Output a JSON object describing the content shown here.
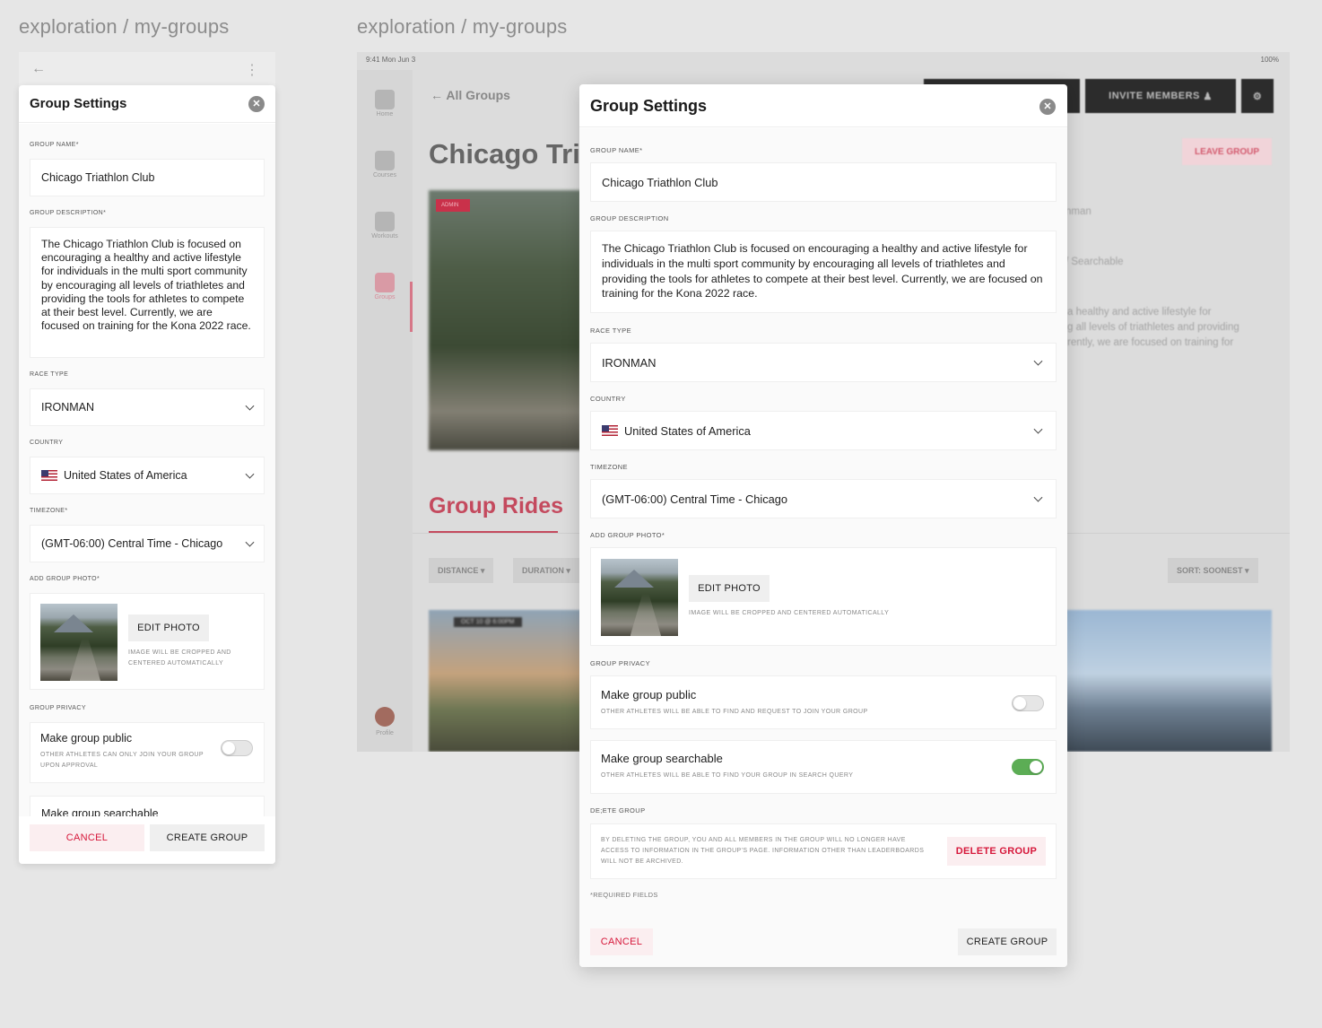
{
  "frames": {
    "left_title": "exploration / my-groups",
    "right_title": "exploration / my-groups"
  },
  "background_app": {
    "status_time": "9:41 Mon Jun 3",
    "status_battery": "100%",
    "nav": [
      "Home",
      "Courses",
      "Workouts",
      "Groups",
      "Profile"
    ],
    "back_label": "All Groups",
    "group_title": "Chicago Tri",
    "admin_badge": "ADMIN",
    "section_title": "Group Rides",
    "filters": [
      "DISTANCE",
      "DURATION"
    ],
    "sort_label": "SORT: SOONEST",
    "ride_date": "OCT 10 @ 6:00PM",
    "invite_label": "INVITE MEMBERS",
    "leave_label": "LEAVE GROUP",
    "ghost_lines": [
      "nman",
      "/ Searchable",
      "a healthy and active lifestyle for",
      "g all levels of triathletes and providing",
      "rently, we are focused on training for"
    ]
  },
  "modal": {
    "title": "Group Settings",
    "group_name_label": "GROUP NAME*",
    "group_name_value": "Chicago Triathlon Club",
    "mobile_description_label": "GROUP DESCRIPTION*",
    "description_label": "GROUP DESCRIPTION",
    "description_value": "The Chicago Triathlon Club is focused on encouraging a healthy and active lifestyle for individuals in the multi sport community by encouraging all levels of triathletes and providing the tools for athletes to compete at their best level. Currently, we are focused on training for the Kona 2022 race.",
    "race_type_label": "RACE TYPE",
    "race_type_value": "IRONMAN",
    "country_label": "COUNTRY",
    "country_value": "United States of America",
    "mobile_timezone_label": "TIMEZONE*",
    "timezone_label": "TIMEZONE",
    "timezone_value": "(GMT-06:00) Central Time - Chicago",
    "photo_label": "ADD GROUP PHOTO*",
    "edit_photo": "EDIT PHOTO",
    "photo_hint": "IMAGE WILL BE CROPPED AND CENTERED AUTOMATICALLY",
    "privacy_label": "GROUP PRIVACY",
    "public_title": "Make group public",
    "public_hint": "OTHER ATHLETES WILL BE ABLE TO FIND AND REQUEST TO JOIN YOUR GROUP",
    "mobile_public_hint": "OTHER ATHLETES CAN ONLY JOIN YOUR GROUP UPON APPROVAL",
    "public_enabled": false,
    "searchable_title": "Make group searchable",
    "searchable_hint": "OTHER ATHLETES WILL BE ABLE TO FIND YOUR GROUP IN SEARCH QUERY",
    "searchable_enabled": true,
    "delete_label": "DE;ETE GROUP",
    "delete_hint": "BY DELETING THE GROUP, YOU AND ALL MEMBERS IN THE GROUP WILL NO LONGER HAVE ACCESS TO INFORMATION IN THE GROUP'S PAGE. INFORMATION OTHER THAN LEADERBOARDS WILL NOT BE ARCHIVED.",
    "delete_button": "DELETE GROUP",
    "required_note": "*REQUIRED FIELDS",
    "cancel": "CANCEL",
    "create": "CREATE GROUP"
  },
  "colors": {
    "accent_red": "#d6173a",
    "toggle_on": "#5cad55"
  },
  "icons": [
    "back-arrow-icon",
    "more-vertical-icon",
    "close-icon",
    "chevron-down-icon",
    "us-flag-icon",
    "gear-icon",
    "add-person-icon"
  ]
}
